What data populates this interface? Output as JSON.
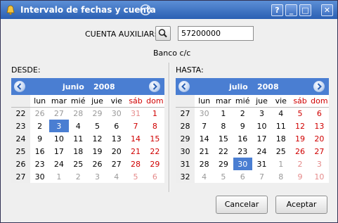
{
  "window": {
    "title": "Intervalo de fechas y cuenta",
    "controls": [
      "?",
      "_",
      "□",
      "✕"
    ]
  },
  "account": {
    "label": "CUENTA AUXILIAR:",
    "value": "57200000",
    "description": "Banco c/c"
  },
  "weekday_headers": [
    "lun",
    "mar",
    "mié",
    "jue",
    "vie",
    "sáb",
    "dom"
  ],
  "from": {
    "label": "DESDE:",
    "month": "junio",
    "year": "2008",
    "weeks": [
      {
        "wk": "22",
        "days": [
          "26",
          "27",
          "28",
          "29",
          "30",
          "31",
          "1"
        ]
      },
      {
        "wk": "23",
        "days": [
          "2",
          "3",
          "4",
          "5",
          "6",
          "7",
          "8"
        ]
      },
      {
        "wk": "24",
        "days": [
          "9",
          "10",
          "11",
          "12",
          "13",
          "14",
          "15"
        ]
      },
      {
        "wk": "25",
        "days": [
          "16",
          "17",
          "18",
          "19",
          "20",
          "21",
          "22"
        ]
      },
      {
        "wk": "26",
        "days": [
          "23",
          "24",
          "25",
          "26",
          "27",
          "28",
          "29"
        ]
      },
      {
        "wk": "27",
        "days": [
          "30",
          "1",
          "2",
          "3",
          "4",
          "5",
          "6"
        ]
      }
    ],
    "selected": "3"
  },
  "to": {
    "label": "HASTA:",
    "month": "julio",
    "year": "2008",
    "weeks": [
      {
        "wk": "27",
        "days": [
          "30",
          "1",
          "2",
          "3",
          "4",
          "5",
          "6"
        ]
      },
      {
        "wk": "28",
        "days": [
          "7",
          "8",
          "9",
          "10",
          "11",
          "12",
          "13"
        ]
      },
      {
        "wk": "29",
        "days": [
          "14",
          "15",
          "16",
          "17",
          "18",
          "19",
          "20"
        ]
      },
      {
        "wk": "30",
        "days": [
          "21",
          "22",
          "23",
          "24",
          "25",
          "26",
          "27"
        ]
      },
      {
        "wk": "31",
        "days": [
          "28",
          "29",
          "30",
          "31",
          "1",
          "2",
          "3"
        ]
      },
      {
        "wk": "32",
        "days": [
          "4",
          "5",
          "6",
          "7",
          "8",
          "9",
          "10"
        ]
      }
    ],
    "selected": "30"
  },
  "buttons": {
    "cancel": "Cancelar",
    "accept": "Aceptar"
  },
  "colors": {
    "titlebar": "#3a6cc2",
    "header": "#4a7ed2",
    "selected": "#4a7ed2",
    "weekend": "#d00000"
  }
}
